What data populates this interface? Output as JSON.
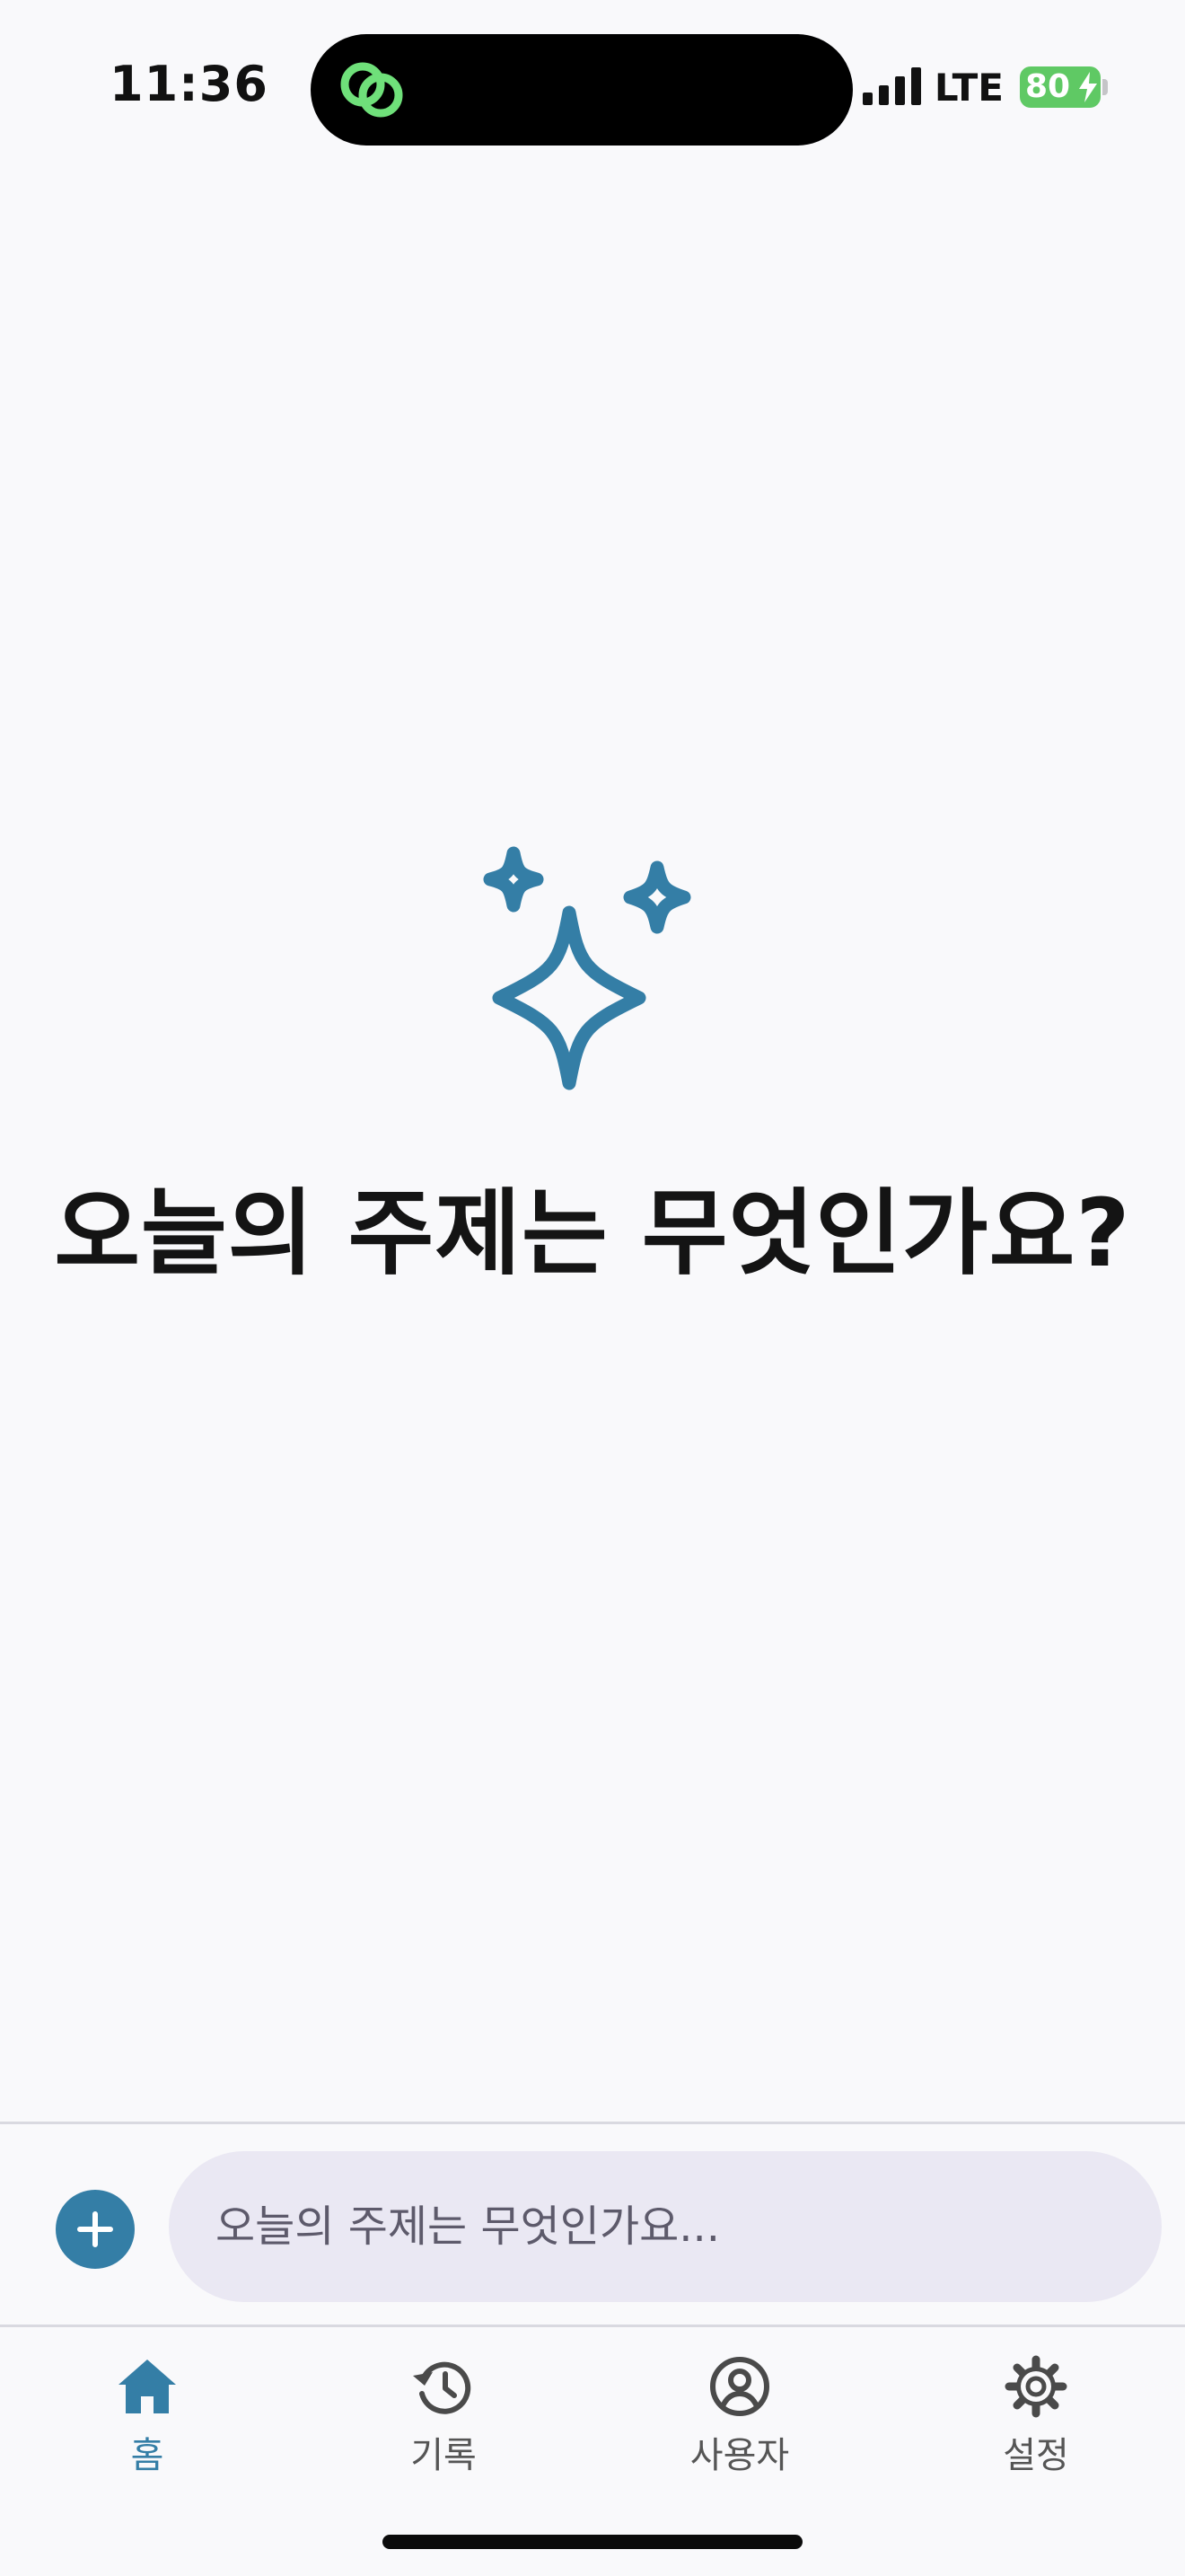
{
  "status_bar": {
    "time": "11:36",
    "network": "LTE",
    "battery_percent": "80",
    "battery_level": 0.8
  },
  "colors": {
    "accent": "#347ea6",
    "island_icon": "#6fe07a",
    "input_background": "#eae8f3",
    "background": "#f9f9fb"
  },
  "hero": {
    "icon": "sparkles-icon",
    "title": "오늘의 주제는 무엇인가요?"
  },
  "composer": {
    "add_icon": "plus-icon",
    "placeholder": "오늘의 주제는 무엇인가요..."
  },
  "tab_bar": {
    "active": "home",
    "items": [
      {
        "id": "home",
        "label": "홈",
        "icon": "home-icon"
      },
      {
        "id": "history",
        "label": "기록",
        "icon": "history-icon"
      },
      {
        "id": "user",
        "label": "사용자",
        "icon": "user-icon"
      },
      {
        "id": "settings",
        "label": "설정",
        "icon": "gear-icon"
      }
    ]
  }
}
